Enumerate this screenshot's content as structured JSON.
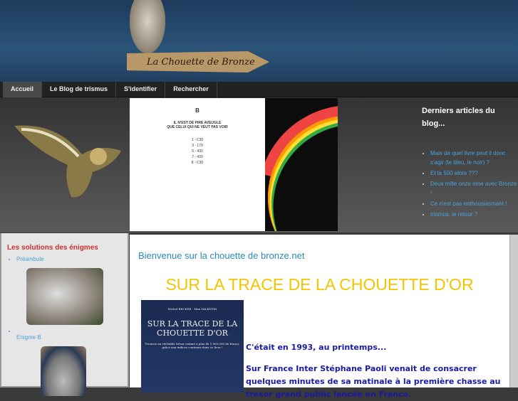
{
  "header": {
    "sign": "La Chouette de Bronze"
  },
  "nav": {
    "items": [
      {
        "label": "Accueil",
        "active": true
      },
      {
        "label": "Le Blog de trismus"
      },
      {
        "label": "S'identifier"
      },
      {
        "label": "Rechercher"
      }
    ]
  },
  "banner_image": {
    "letter": "B",
    "title1": "IL N'EST DE PIRE AVEUGLE",
    "title2": "QUE CELUI QUI NE VEUT PAS VOIR",
    "lines": [
      "1 - C30",
      "3 - 170",
      "5 - 430",
      "7 - 420",
      "8 - C30"
    ]
  },
  "blog": {
    "title": "Derniers articles du blog...",
    "items": [
      "Mais de quel livre peut il donc s'agir (le bleu, le noir) ?",
      "Et la 500 alors ???",
      "Deux mille onze rime avec Bronze !",
      "Ce n'est pas enthousiasmant !",
      "trismus, le retour ?"
    ]
  },
  "left": {
    "title": "Les solutions des énigmes",
    "items": [
      "Préambule",
      "Enigme B"
    ]
  },
  "main": {
    "welcome": "Bienvenue sur la chouette de bronze.net",
    "heading": "SUR LA TRACE DE LA CHOUETTE D'OR",
    "book": {
      "authors": "Michel BECKER · Max VALENTIN",
      "title": "SUR LA TRACE DE LA CHOUETTE D'OR",
      "subtitle": "Trouvez un véritable trésor estimé à plus de 1.000.000 de francs, grâce aux indices contenus dans ce livre !"
    },
    "p1": "C'était en 1993, au printemps...",
    "p2": "Sur France Inter Stéphane Paoli venait de consacrer quelques minutes de sa matinale à la première chasse au trésor grand public lancée en France."
  }
}
